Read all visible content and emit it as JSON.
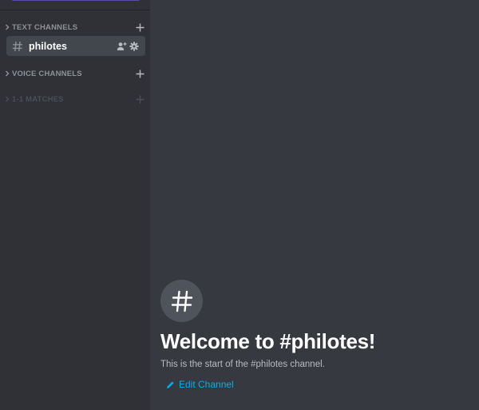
{
  "sidebar": {
    "categories": [
      {
        "label": "TEXT CHANNELS"
      },
      {
        "label": "VOICE CHANNELS"
      },
      {
        "label": "1-1 MATCHES"
      }
    ],
    "channels": [
      {
        "name": "philotes"
      }
    ]
  },
  "main": {
    "welcome_title": "Welcome to #philotes!",
    "welcome_subtitle": "This is the start of the #philotes channel.",
    "edit_channel_label": "Edit Channel"
  },
  "colors": {
    "sidebar_bg": "#2f3136",
    "main_bg": "#36393f",
    "link": "#00b0f4",
    "selected_channel_bg": "#42464d"
  },
  "icons": [
    "chevron-right-icon",
    "add-icon",
    "hash-icon",
    "add-member-icon",
    "gear-icon",
    "pencil-icon"
  ]
}
